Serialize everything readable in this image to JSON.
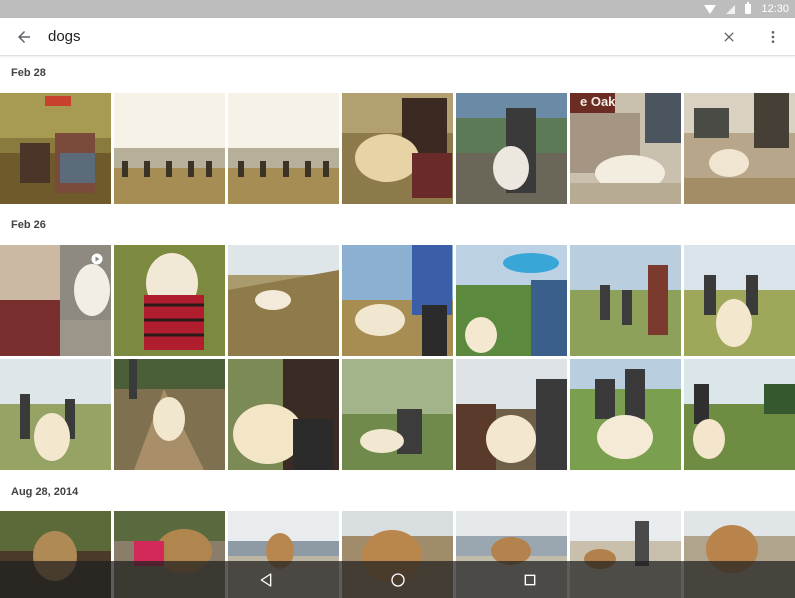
{
  "status_bar": {
    "time": "12:30"
  },
  "search": {
    "query": "dogs"
  },
  "sections": [
    {
      "date": "Feb 28"
    },
    {
      "date": "Feb 26"
    },
    {
      "date": "Aug 28, 2014"
    }
  ],
  "photo_sign_text": "e Oak"
}
